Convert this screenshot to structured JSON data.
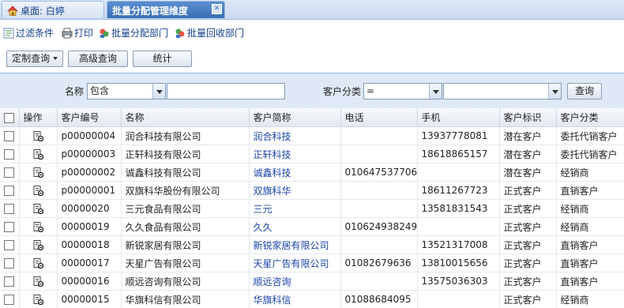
{
  "tabs": [
    {
      "label": "桌面: 白婷"
    },
    {
      "label": "批量分配管理维度"
    }
  ],
  "toolbar": {
    "filter_label": "过滤条件",
    "print_label": "打印",
    "assign_label": "批量分配部门",
    "recall_label": "批量回收部门"
  },
  "buttons": {
    "custom_query": "定制查询",
    "advanced_query": "高级查询",
    "stats": "统计"
  },
  "filter": {
    "name_label": "名称",
    "name_operator": "包含",
    "name_value": "",
    "category_label": "客户分类",
    "category_operator": "=",
    "category_value": "",
    "search_button": "查询"
  },
  "table": {
    "columns": [
      "操作",
      "客户编号",
      "名称",
      "客户简称",
      "电话",
      "手机",
      "客户标识",
      "客户分类"
    ],
    "rows": [
      {
        "code": "p00000004",
        "name": "润合科技有限公司",
        "short": "润合科技",
        "phone": "",
        "mobile": "13937778081",
        "flag": "潜在客户",
        "category": "委托代销客户"
      },
      {
        "code": "p00000003",
        "name": "正轩科技有限公司",
        "short": "正轩科技",
        "phone": "",
        "mobile": "18618865157",
        "flag": "潜在客户",
        "category": "委托代销客户"
      },
      {
        "code": "p00000002",
        "name": "诚鑫科技有限公司",
        "short": "诚鑫科技",
        "phone": "010647537706",
        "mobile": "",
        "flag": "潜在客户",
        "category": "经销商"
      },
      {
        "code": "p00000001",
        "name": "双旗科华股份有限公司",
        "short": "双旗科华",
        "phone": "",
        "mobile": "18611267723",
        "flag": "正式客户",
        "category": "直销客户"
      },
      {
        "code": "00000020",
        "name": "三元食品有限公司",
        "short": "三元",
        "phone": "",
        "mobile": "13581831543",
        "flag": "正式客户",
        "category": "经销商"
      },
      {
        "code": "00000019",
        "name": "久久食品有限公司",
        "short": "久久",
        "phone": "010624938249",
        "mobile": "",
        "flag": "正式客户",
        "category": "经销商"
      },
      {
        "code": "00000018",
        "name": "新锐家居有限公司",
        "short": "新锐家居有限公司",
        "phone": "",
        "mobile": "13521317008",
        "flag": "正式客户",
        "category": "直销客户"
      },
      {
        "code": "00000017",
        "name": "天星广告有限公司",
        "short": "天星广告有限公司",
        "phone": "01082679636",
        "mobile": "13810015656",
        "flag": "正式客户",
        "category": "直销客户"
      },
      {
        "code": "00000016",
        "name": "顺远咨询有限公司",
        "short": "顺远咨询",
        "phone": "",
        "mobile": "13575036303",
        "flag": "正式客户",
        "category": "直销客户"
      },
      {
        "code": "00000015",
        "name": "华旗科信有限公司",
        "short": "华旗科信",
        "phone": "01088684095",
        "mobile": "",
        "flag": "正式客户",
        "category": "经销商"
      }
    ]
  }
}
